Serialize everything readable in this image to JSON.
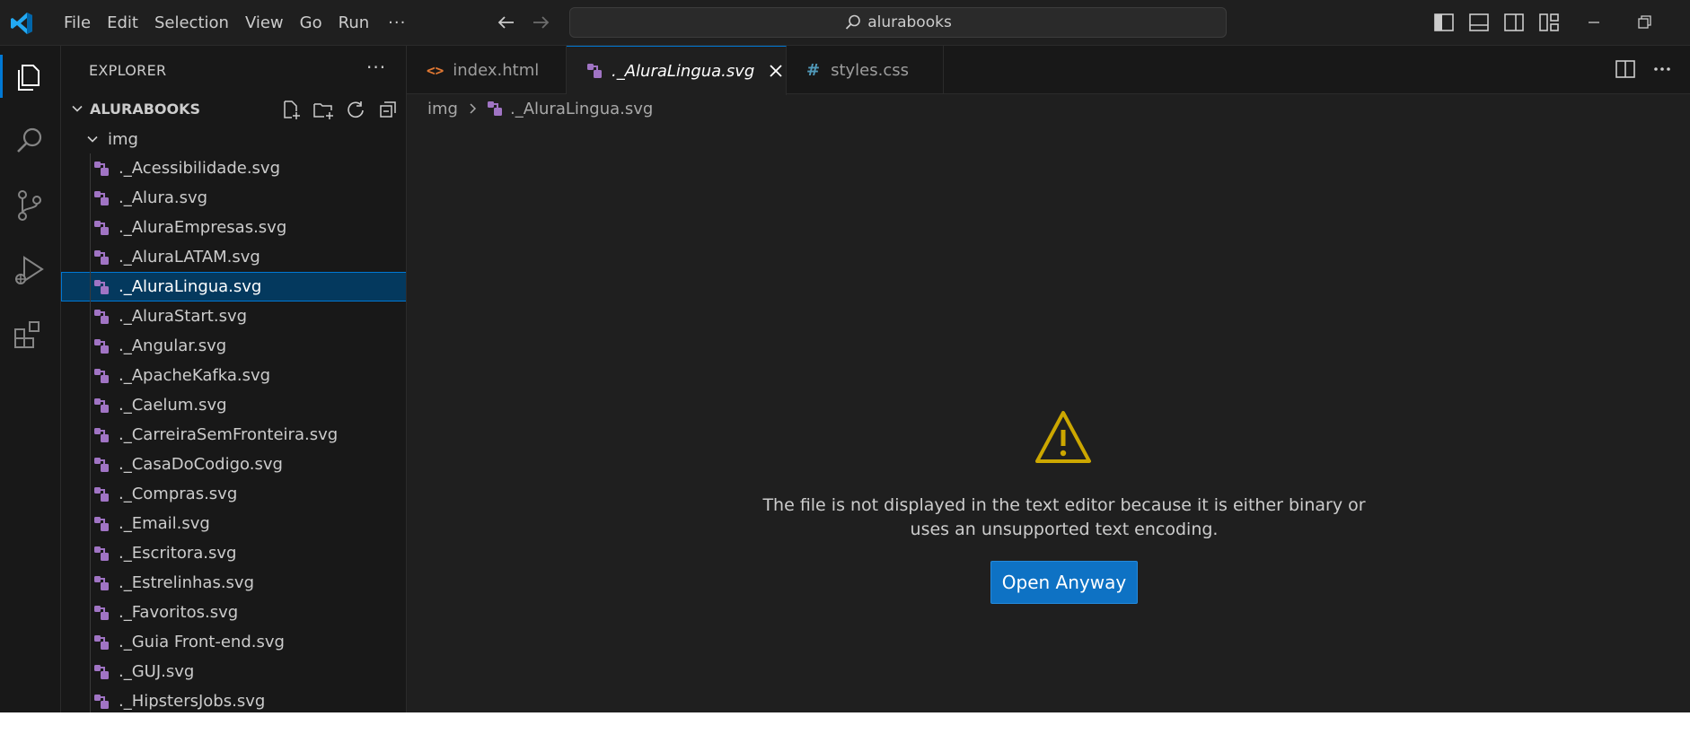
{
  "titlebar": {
    "menu": [
      "File",
      "Edit",
      "Selection",
      "View",
      "Go",
      "Run"
    ],
    "more": "···",
    "search_text": "alurabooks"
  },
  "explorer": {
    "header": "EXPLORER",
    "more": "···",
    "root_label": "ALURABOOKS",
    "folder_label": "img",
    "files": [
      "._Acessibilidade.svg",
      "._Alura.svg",
      "._AluraEmpresas.svg",
      "._AluraLATAM.svg",
      "._AluraLingua.svg",
      "._AluraStart.svg",
      "._Angular.svg",
      "._ApacheKafka.svg",
      "._Caelum.svg",
      "._CarreiraSemFronteira.svg",
      "._CasaDoCodigo.svg",
      "._Compras.svg",
      "._Email.svg",
      "._Escritora.svg",
      "._Estrelinhas.svg",
      "._Favoritos.svg",
      "._Guia Front-end.svg",
      "._GUJ.svg",
      "._HipstersJobs.svg"
    ],
    "selected_file": "._AluraLingua.svg"
  },
  "tabs": [
    {
      "label": "index.html",
      "icon": "html-icon"
    },
    {
      "label": "._AluraLingua.svg",
      "icon": "svg-file-icon"
    },
    {
      "label": "styles.css",
      "icon": "css-icon"
    }
  ],
  "breadcrumb": {
    "folder": "img",
    "file": "._AluraLingua.svg"
  },
  "editor": {
    "message_line1": "The file is not displayed in the text editor because it is either binary or",
    "message_line2": "uses an unsupported text encoding.",
    "open_button": "Open Anyway"
  },
  "colors": {
    "accent": "#0078d4",
    "button": "#0e72c4",
    "warning": "#cca700",
    "svg_icon": "#a074c4",
    "html_icon": "#e37933",
    "css_icon": "#519aba"
  }
}
